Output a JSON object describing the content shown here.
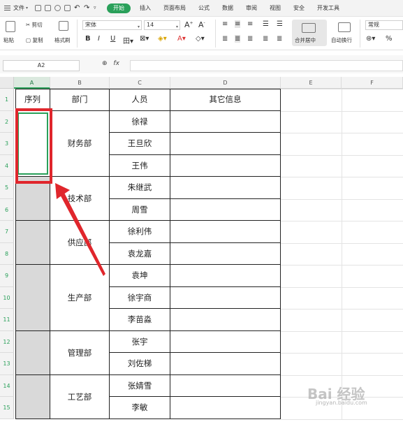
{
  "menu": {
    "file_label": "文件",
    "tabs": [
      "开始",
      "插入",
      "页面布局",
      "公式",
      "数据",
      "审阅",
      "视图",
      "安全",
      "开发工具"
    ],
    "active_tab": "开始"
  },
  "ribbon": {
    "format_painter_group": {
      "paste": "粘贴",
      "cut": "剪切",
      "copy": "复制",
      "format_painter": "格式刷"
    },
    "font_name": "宋体",
    "font_size": "14",
    "bold": "B",
    "italic": "I",
    "underline": "U",
    "merge_center": "合并居中",
    "wrap_text": "自动换行",
    "number_format": "常规",
    "percent": "%"
  },
  "formula_bar": {
    "cell_ref": "A2",
    "fx": "fx",
    "content": ""
  },
  "columns": [
    "A",
    "B",
    "C",
    "D",
    "E",
    "F"
  ],
  "rows": [
    "1",
    "2",
    "3",
    "4",
    "5",
    "6",
    "7",
    "8",
    "9",
    "10",
    "11",
    "12",
    "13",
    "14",
    "15"
  ],
  "table": {
    "headers": [
      "序列",
      "部门",
      "人员",
      "其它信息"
    ],
    "departments": [
      "财务部",
      "技术部",
      "供应部",
      "生产部",
      "管理部",
      "工艺部"
    ],
    "people": [
      "徐禄",
      "王旦欣",
      "王伟",
      "朱继武",
      "周雪",
      "徐利伟",
      "袁龙嘉",
      "袁坤",
      "徐宇商",
      "李苗淼",
      "张宇",
      "刘佐梯",
      "张婧雪",
      "李敏"
    ]
  },
  "colors": {
    "accent": "#2aa05a",
    "highlight": "#e0262c",
    "merged_grey": "#d9d9d9"
  },
  "watermark": "Bai 经验",
  "watermark_sub": "jingyan.baidu.com"
}
